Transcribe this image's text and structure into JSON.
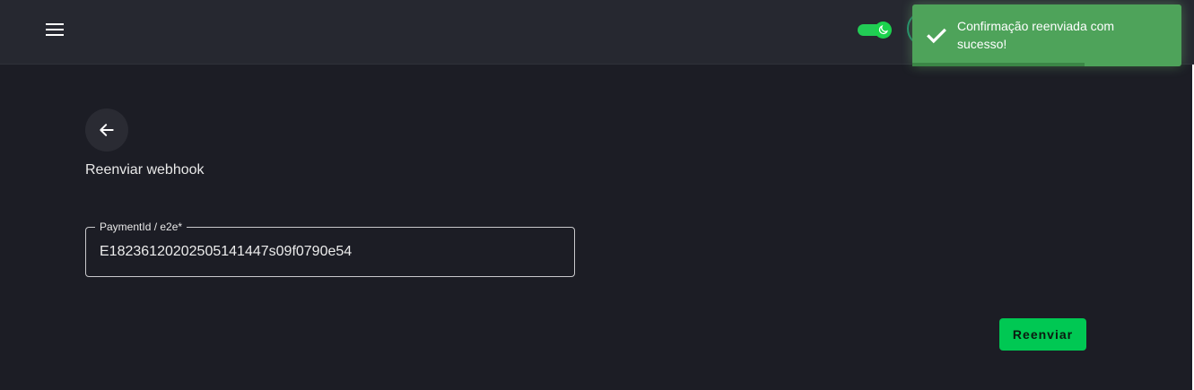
{
  "header": {
    "menu_icon": "menu-icon",
    "theme_toggle": {
      "state": "on",
      "icon": "moon-icon",
      "color": "#22cc55"
    }
  },
  "toast": {
    "message": "Confirmação reenviada com sucesso!",
    "icon": "check-icon",
    "color": "#4ea35a",
    "progress": 0.64
  },
  "page": {
    "back_icon": "arrow-left-icon",
    "title": "Reenviar webhook"
  },
  "form": {
    "payment_field": {
      "label": "PaymentId / e2e*",
      "value": "E18236120202505141447s09f0790e54"
    },
    "submit_label": "Reenviar",
    "submit_color": "#00c853"
  }
}
